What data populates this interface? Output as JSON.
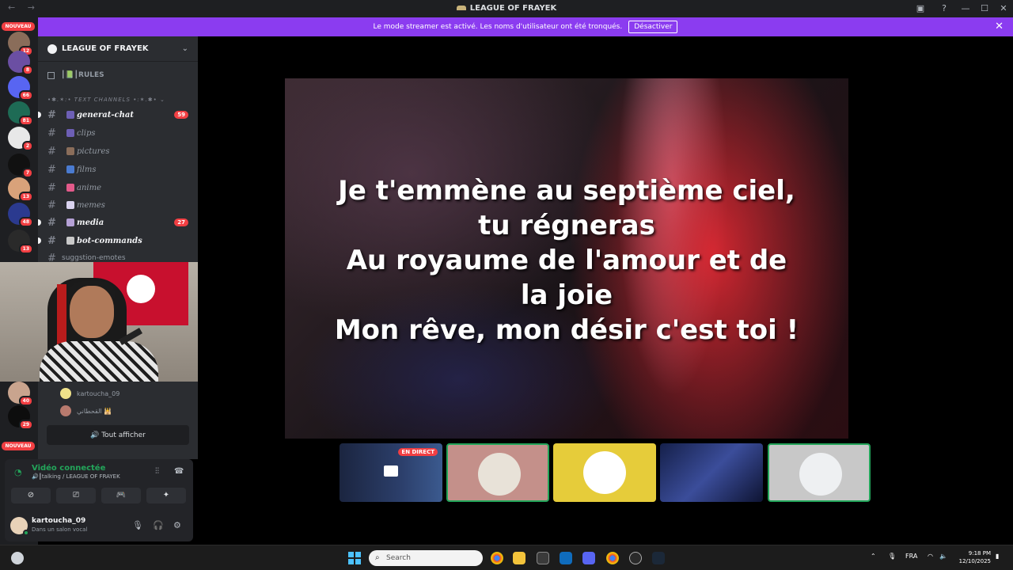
{
  "window": {
    "title": "LEAGUE OF FRAYEK",
    "nav": "← →",
    "icons": [
      "inbox-icon",
      "help-icon"
    ],
    "controls": [
      "—",
      "☐",
      "✕"
    ]
  },
  "banner": {
    "message": "Le mode streamer est activé. Les noms d'utilisateur ont été tronqués.",
    "button": "Désactiver",
    "close": "✕"
  },
  "servers": {
    "nouveau_top": "NOUVEAU",
    "nouveau_bottom": "NOUVEAU",
    "badges": [
      "12",
      "8",
      "66",
      "81",
      "2",
      "7",
      "13",
      "48",
      "13",
      "40",
      "29"
    ]
  },
  "guild": {
    "name": "LEAGUE OF FRAYEK",
    "chevron": "⌄",
    "rules": "┃📗┃RULES",
    "category": "•✱.✶:• TEXT CHANNELS •:✶.✱• ⌄",
    "channels": [
      {
        "name": "generat-chat",
        "unread": true,
        "mention": "59"
      },
      {
        "name": "clips",
        "unread": false,
        "mention": ""
      },
      {
        "name": "pictures",
        "unread": false,
        "mention": ""
      },
      {
        "name": "films",
        "unread": false,
        "mention": ""
      },
      {
        "name": "anime",
        "unread": false,
        "mention": ""
      },
      {
        "name": "memes",
        "unread": false,
        "mention": ""
      },
      {
        "name": "media",
        "unread": true,
        "mention": "27"
      },
      {
        "name": "bot-commands",
        "unread": true,
        "mention": ""
      },
      {
        "name": "suggstion-emotes",
        "unread": false,
        "mention": ""
      }
    ],
    "voice_users": [
      {
        "name": "kartoucha_09"
      },
      {
        "name": "القحطاني 🕌"
      }
    ],
    "show_all": "🔊 Tout afficher"
  },
  "voice_panel": {
    "status": "Vidéo connectée",
    "sub": "🔊┃talking / LEAGUE OF FRAYEK",
    "buttons": [
      "⊘",
      "⎚",
      "🎮",
      "✦"
    ]
  },
  "user": {
    "name": "kartoucha_09",
    "status": "Dans un salon vocal"
  },
  "lyrics": [
    "Je t'emmène au septième ciel,",
    "tu régneras",
    "Au royaume de l'amour et de",
    "la joie",
    "Mon rêve, mon désir c'est toi !"
  ],
  "participants": {
    "live_label": "EN DIRECT"
  },
  "taskbar": {
    "search": "Search",
    "lang": "FRA",
    "time": "9:18 PM",
    "date": "12/10/2025"
  },
  "colors": {
    "accent": "#8b3cf0",
    "speaking": "#23a55a",
    "mention": "#f23f43"
  }
}
